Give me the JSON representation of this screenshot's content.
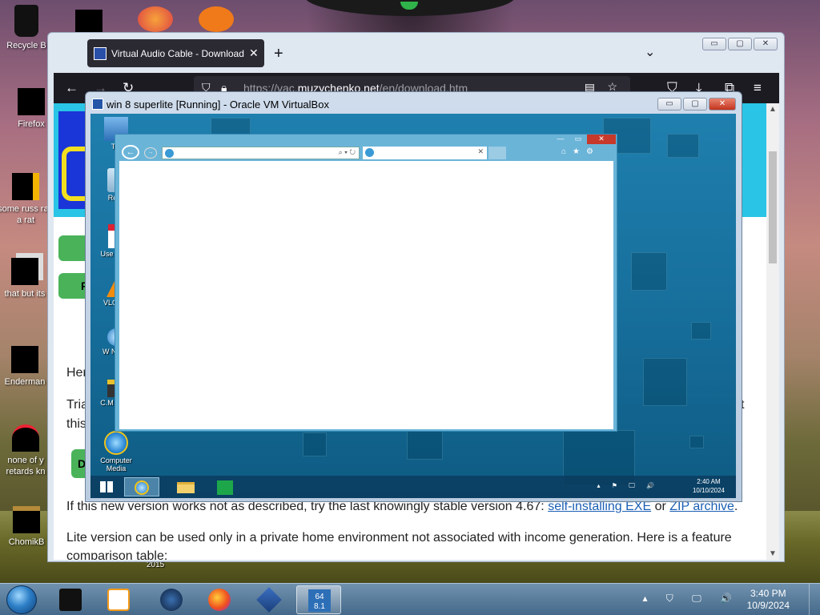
{
  "desktop": {
    "icons": [
      {
        "name": "recycle-bin",
        "label": "Recycle B"
      },
      {
        "name": "firefox",
        "label": "Firefox"
      },
      {
        "name": "some-russ",
        "label": "some russ ran a rat"
      },
      {
        "name": "that-but-its",
        "label": "that but its"
      },
      {
        "name": "enderman",
        "label": "Enderman"
      },
      {
        "name": "none-of-y",
        "label": "none of y retards kn"
      },
      {
        "name": "chomikb",
        "label": "ChomikB"
      }
    ],
    "year_label": "2015"
  },
  "firefox": {
    "tab_title": "Virtual Audio Cable - Download",
    "tab_close": "✕",
    "new_tab": "+",
    "all_tabs": "⌄",
    "url_prefix": "https://vac.",
    "url_domain": "muzychenko.net",
    "url_suffix": "/en/download.htm",
    "page": {
      "btn1": "",
      "btn2": "F",
      "btn3": "D",
      "line_here": "Her",
      "line_trial": "Tria",
      "line_this": "this",
      "line_trial_end": "t",
      "line_new_version": "If this new version works not as described, try the last knowingly stable version 4.67:",
      "link_exe": "self-installing EXE",
      "link_or": "or",
      "link_zip": "ZIP archive",
      "line_lite": "Lite version can be used only in a private home environment not associated with income generation. Here is a feature",
      "line_comparison": "comparison table:"
    }
  },
  "vbox": {
    "title": "win 8 superlite [Running] - Oracle VM VirtualBox",
    "guest": {
      "icons": [
        {
          "name": "this-pc",
          "label": "Thi"
        },
        {
          "name": "recycle-bin",
          "label": "Recy"
        },
        {
          "name": "user-secur",
          "label": "Use Secu"
        },
        {
          "name": "vlc",
          "label": "VLC pla"
        },
        {
          "name": "navigator",
          "label": "W Navig"
        },
        {
          "name": "gm-paket",
          "label": "C.M Pake"
        },
        {
          "name": "computer-media",
          "label": "Computer Media"
        }
      ],
      "ie": {
        "min": "—",
        "max": "▭",
        "close": "✕",
        "addr_tools": "⌕ ▾ ↻",
        "tab_close": "✕",
        "toolbar": "⌂★⚙"
      },
      "clock_time": "2:40 AM",
      "clock_date": "10/10/2024",
      "tray": "▴ ⚑ 🖵 🔊"
    }
  },
  "taskbar": {
    "clock_time": "3:40 PM",
    "clock_date": "10/9/2024",
    "tray": "▴ ⛉ 🖵 🔊",
    "apps": [
      "notepad-app",
      "media-player",
      "globe-app",
      "firefox",
      "virtualbox",
      "win81-vm"
    ],
    "win81_badge": "8.1",
    "win81_bits": "64"
  },
  "colors": {
    "firefox_dark": "#1c1b22",
    "banner_cyan": "#29c4e6",
    "guest_blue": "#1f7fae"
  }
}
